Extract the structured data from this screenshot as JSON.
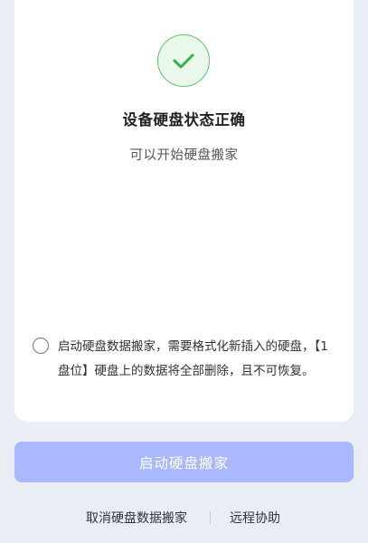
{
  "status": {
    "icon": "check-icon",
    "title": "设备硬盘状态正确",
    "subtitle": "可以开始硬盘搬家"
  },
  "agreement": {
    "checked": false,
    "text": "启动硬盘数据搬家，需要格式化新插入的硬盘，【1盘位】硬盘上的数据将全部删除，且不可恢复。"
  },
  "actions": {
    "primary_label": "启动硬盘搬家",
    "primary_enabled": false,
    "cancel_label": "取消硬盘数据搬家",
    "remote_label": "远程协助"
  },
  "colors": {
    "background": "#e9edf6",
    "success": "#2fb344",
    "primary_disabled": "#a9b8ff"
  }
}
